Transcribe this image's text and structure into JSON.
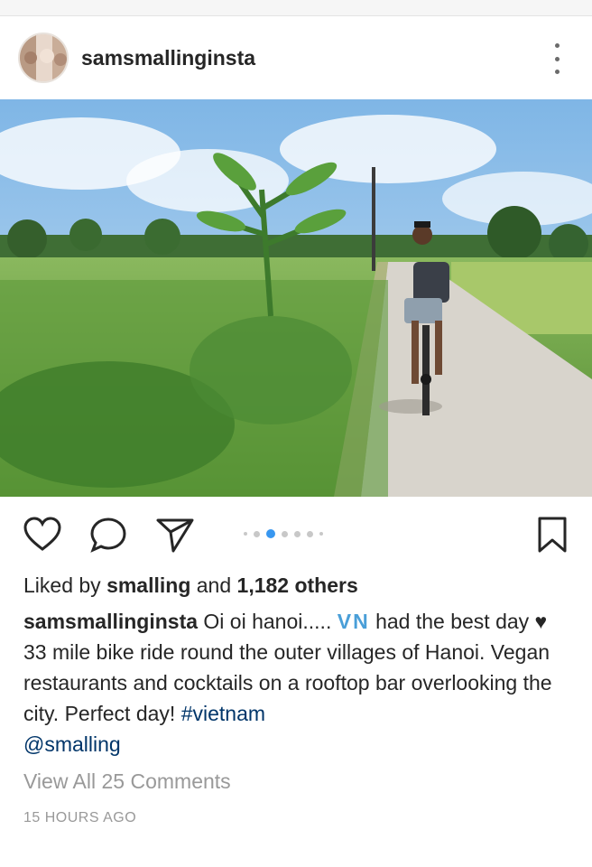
{
  "post": {
    "username": "samsmallinginsta",
    "liked_prefix": "Liked by",
    "liked_user": "smalling",
    "liked_and": "and",
    "liked_count": "1,182 others",
    "caption_user": "samsmallinginsta",
    "caption_part1": "Oi oi hanoi.....",
    "caption_flag": "VN",
    "caption_part2": "had the best day",
    "caption_heart": "♥",
    "caption_part3": "33 mile bike ride round the outer villages of Hanoi. Vegan restaurants and cocktails on a rooftop bar overlooking the city. Perfect day!",
    "hashtag": "#vietnam",
    "mention": "@smalling",
    "comments_link": "View All 25 Comments",
    "timestamp": "15 HOURS AGO",
    "carousel": {
      "total": 7,
      "active_index": 2
    }
  },
  "icons": {
    "avatar": "avatar",
    "more": "more-vertical-icon",
    "like": "heart-icon",
    "comment": "comment-icon",
    "share": "send-icon",
    "save": "bookmark-icon"
  },
  "colors": {
    "accent": "#3897f0",
    "hashtag": "#003569",
    "muted": "#999999",
    "text": "#262626"
  }
}
